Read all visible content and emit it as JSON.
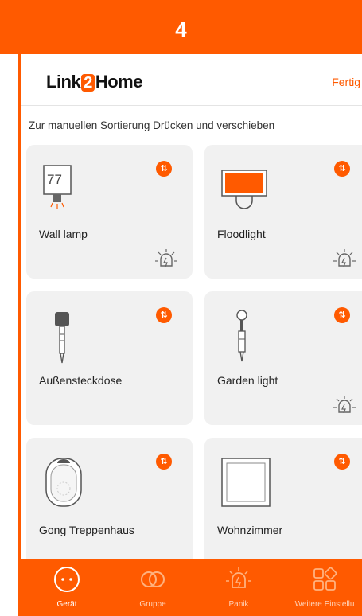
{
  "banner": {
    "step": "4"
  },
  "header": {
    "logo_pre": "Link",
    "logo_mid": "2",
    "logo_post": "Home",
    "done_label": "Fertig"
  },
  "hint": "Zur manuellen Sortierung Drücken und verschieben",
  "devices": [
    {
      "name": "Wall lamp",
      "icon": "wall-lamp-icon",
      "display": "77",
      "has_alarm": true
    },
    {
      "name": "Floodlight",
      "icon": "floodlight-icon",
      "has_alarm": true
    },
    {
      "name": "Außensteckdose",
      "icon": "outdoor-socket-icon",
      "has_alarm": false
    },
    {
      "name": "Garden light",
      "icon": "garden-light-icon",
      "has_alarm": true
    },
    {
      "name": "Gong Treppenhaus",
      "icon": "gong-icon",
      "has_alarm": false
    },
    {
      "name": "Wohnzimmer",
      "icon": "wall-switch-icon",
      "has_alarm": false
    }
  ],
  "tabs": [
    {
      "label": "Gerät",
      "icon": "device-icon",
      "active": true
    },
    {
      "label": "Gruppe",
      "icon": "group-icon",
      "active": false
    },
    {
      "label": "Panik",
      "icon": "panic-alarm-icon",
      "active": false
    },
    {
      "label": "Weitere Einstellu",
      "icon": "more-settings-icon",
      "active": false
    }
  ],
  "colors": {
    "accent": "#ff5a00",
    "card": "#f1f1f1",
    "text": "#222222"
  }
}
